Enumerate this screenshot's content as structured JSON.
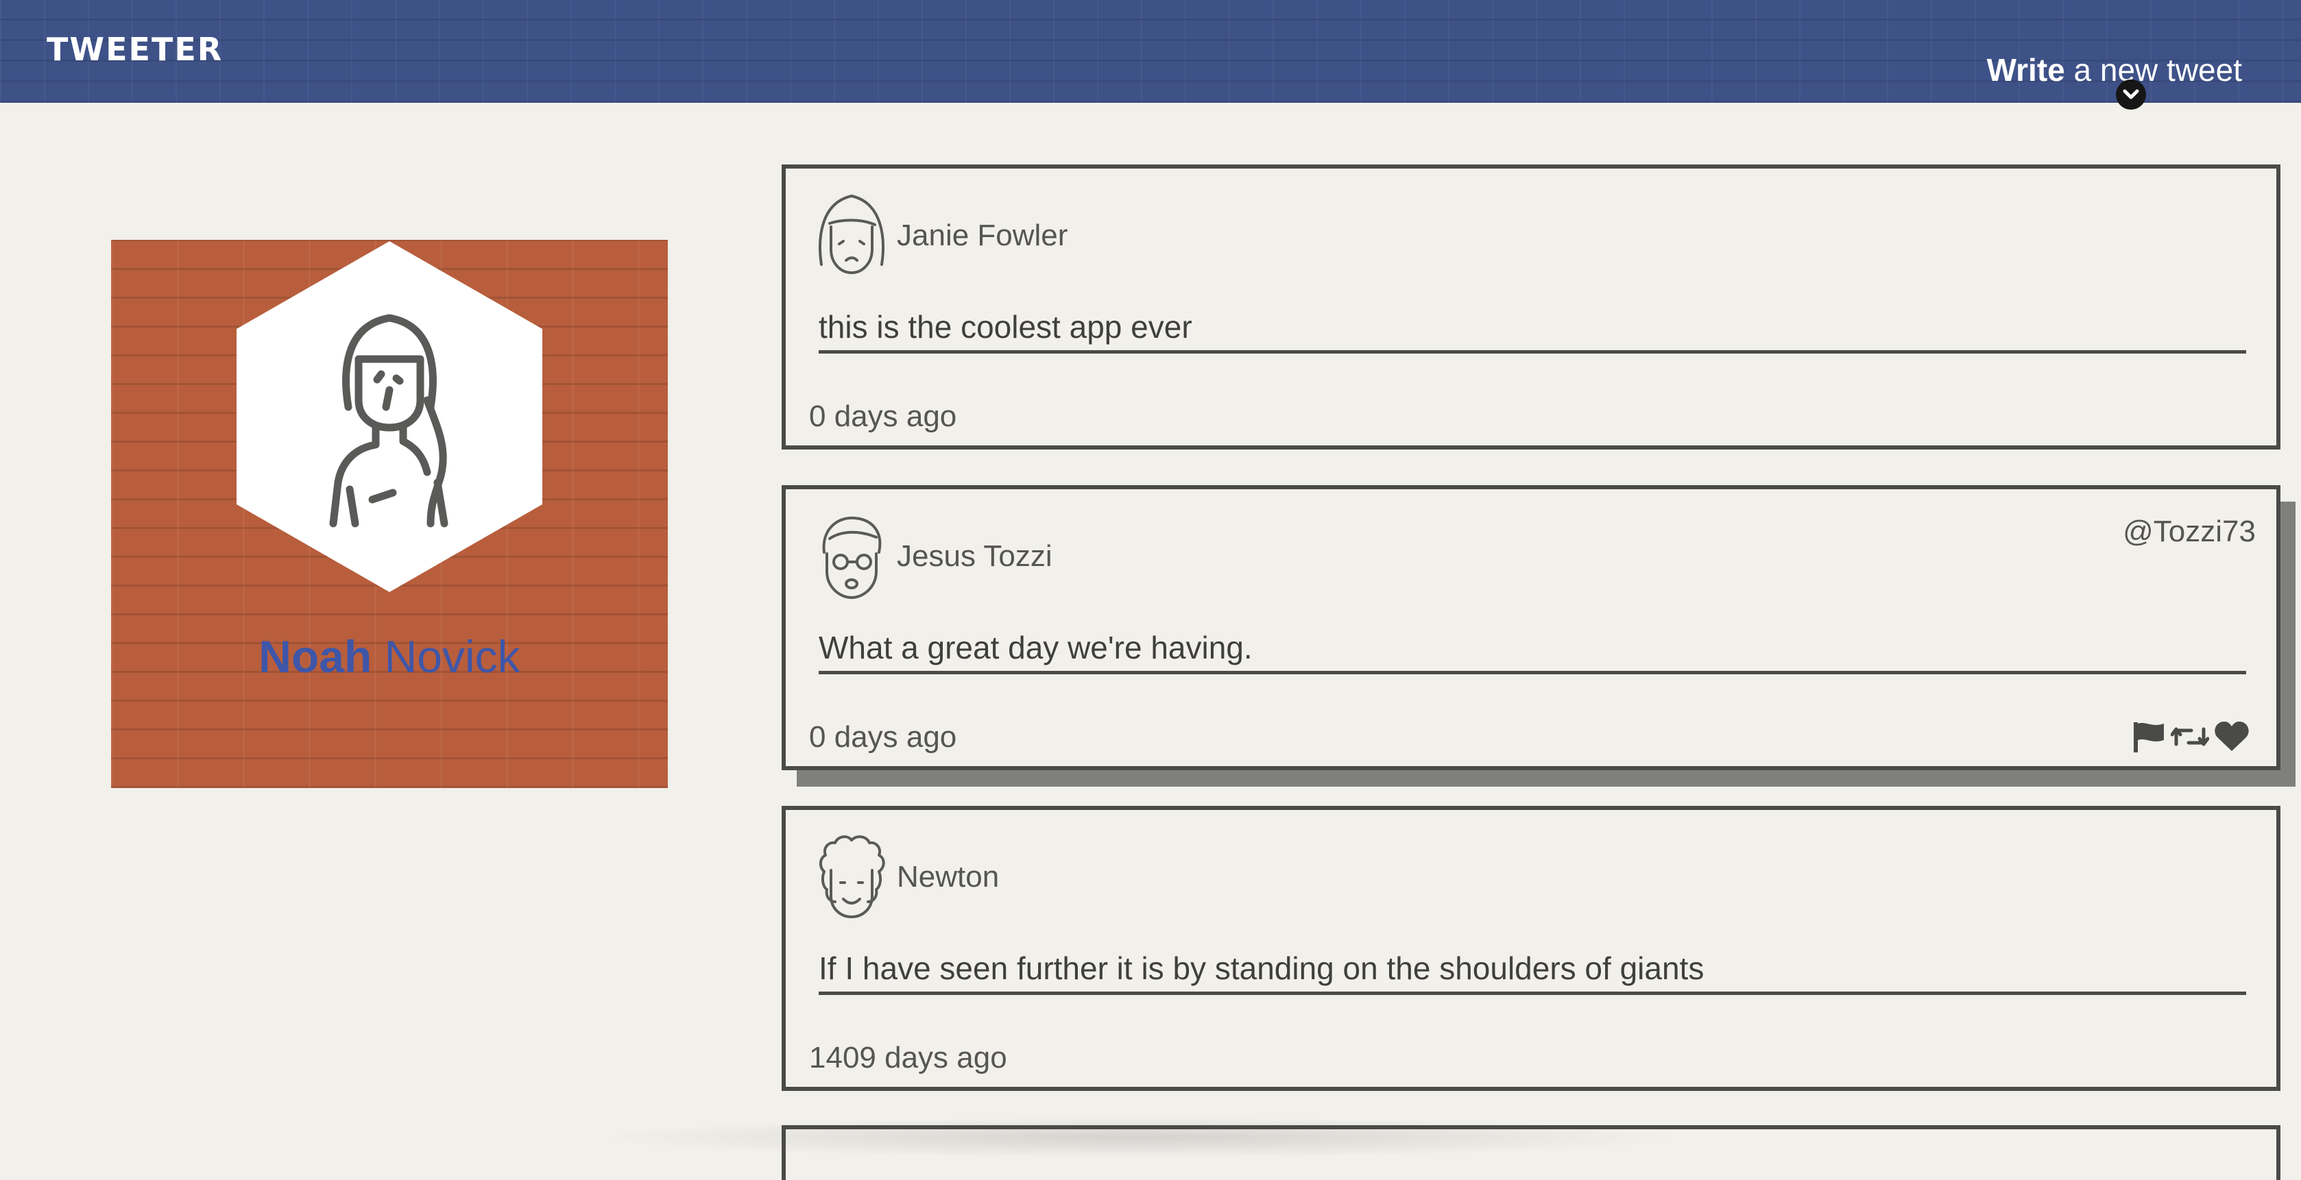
{
  "nav": {
    "logo": "TWEETER",
    "compose_bold": "Write",
    "compose_rest": "a new tweet"
  },
  "profile": {
    "first_name": "Noah",
    "last_name": "Novick",
    "avatar_icon": "woman-avatar-icon",
    "bg_color": "#b85e3c",
    "name_color": "#3f56a8"
  },
  "tweets": [
    {
      "author": "Janie Fowler",
      "handle": "",
      "text": "this is the coolest app ever",
      "timestamp": "0 days ago",
      "avatar_icon": "woman-face-icon"
    },
    {
      "author": "Jesus Tozzi",
      "handle": "@Tozzi73",
      "text": "What a great day we're having.",
      "timestamp": "0 days ago",
      "avatar_icon": "man-glasses-face-icon",
      "actions": [
        "flag-icon",
        "retweet-icon",
        "heart-icon"
      ]
    },
    {
      "author": "Newton",
      "handle": "",
      "text": "If I have seen further it is by standing on the shoulders of giants",
      "timestamp": "1409 days ago",
      "avatar_icon": "curly-hair-face-icon"
    }
  ],
  "colors": {
    "nav": "#3e5288",
    "page_bg": "#f2f0eb",
    "border": "#4a4a48"
  }
}
